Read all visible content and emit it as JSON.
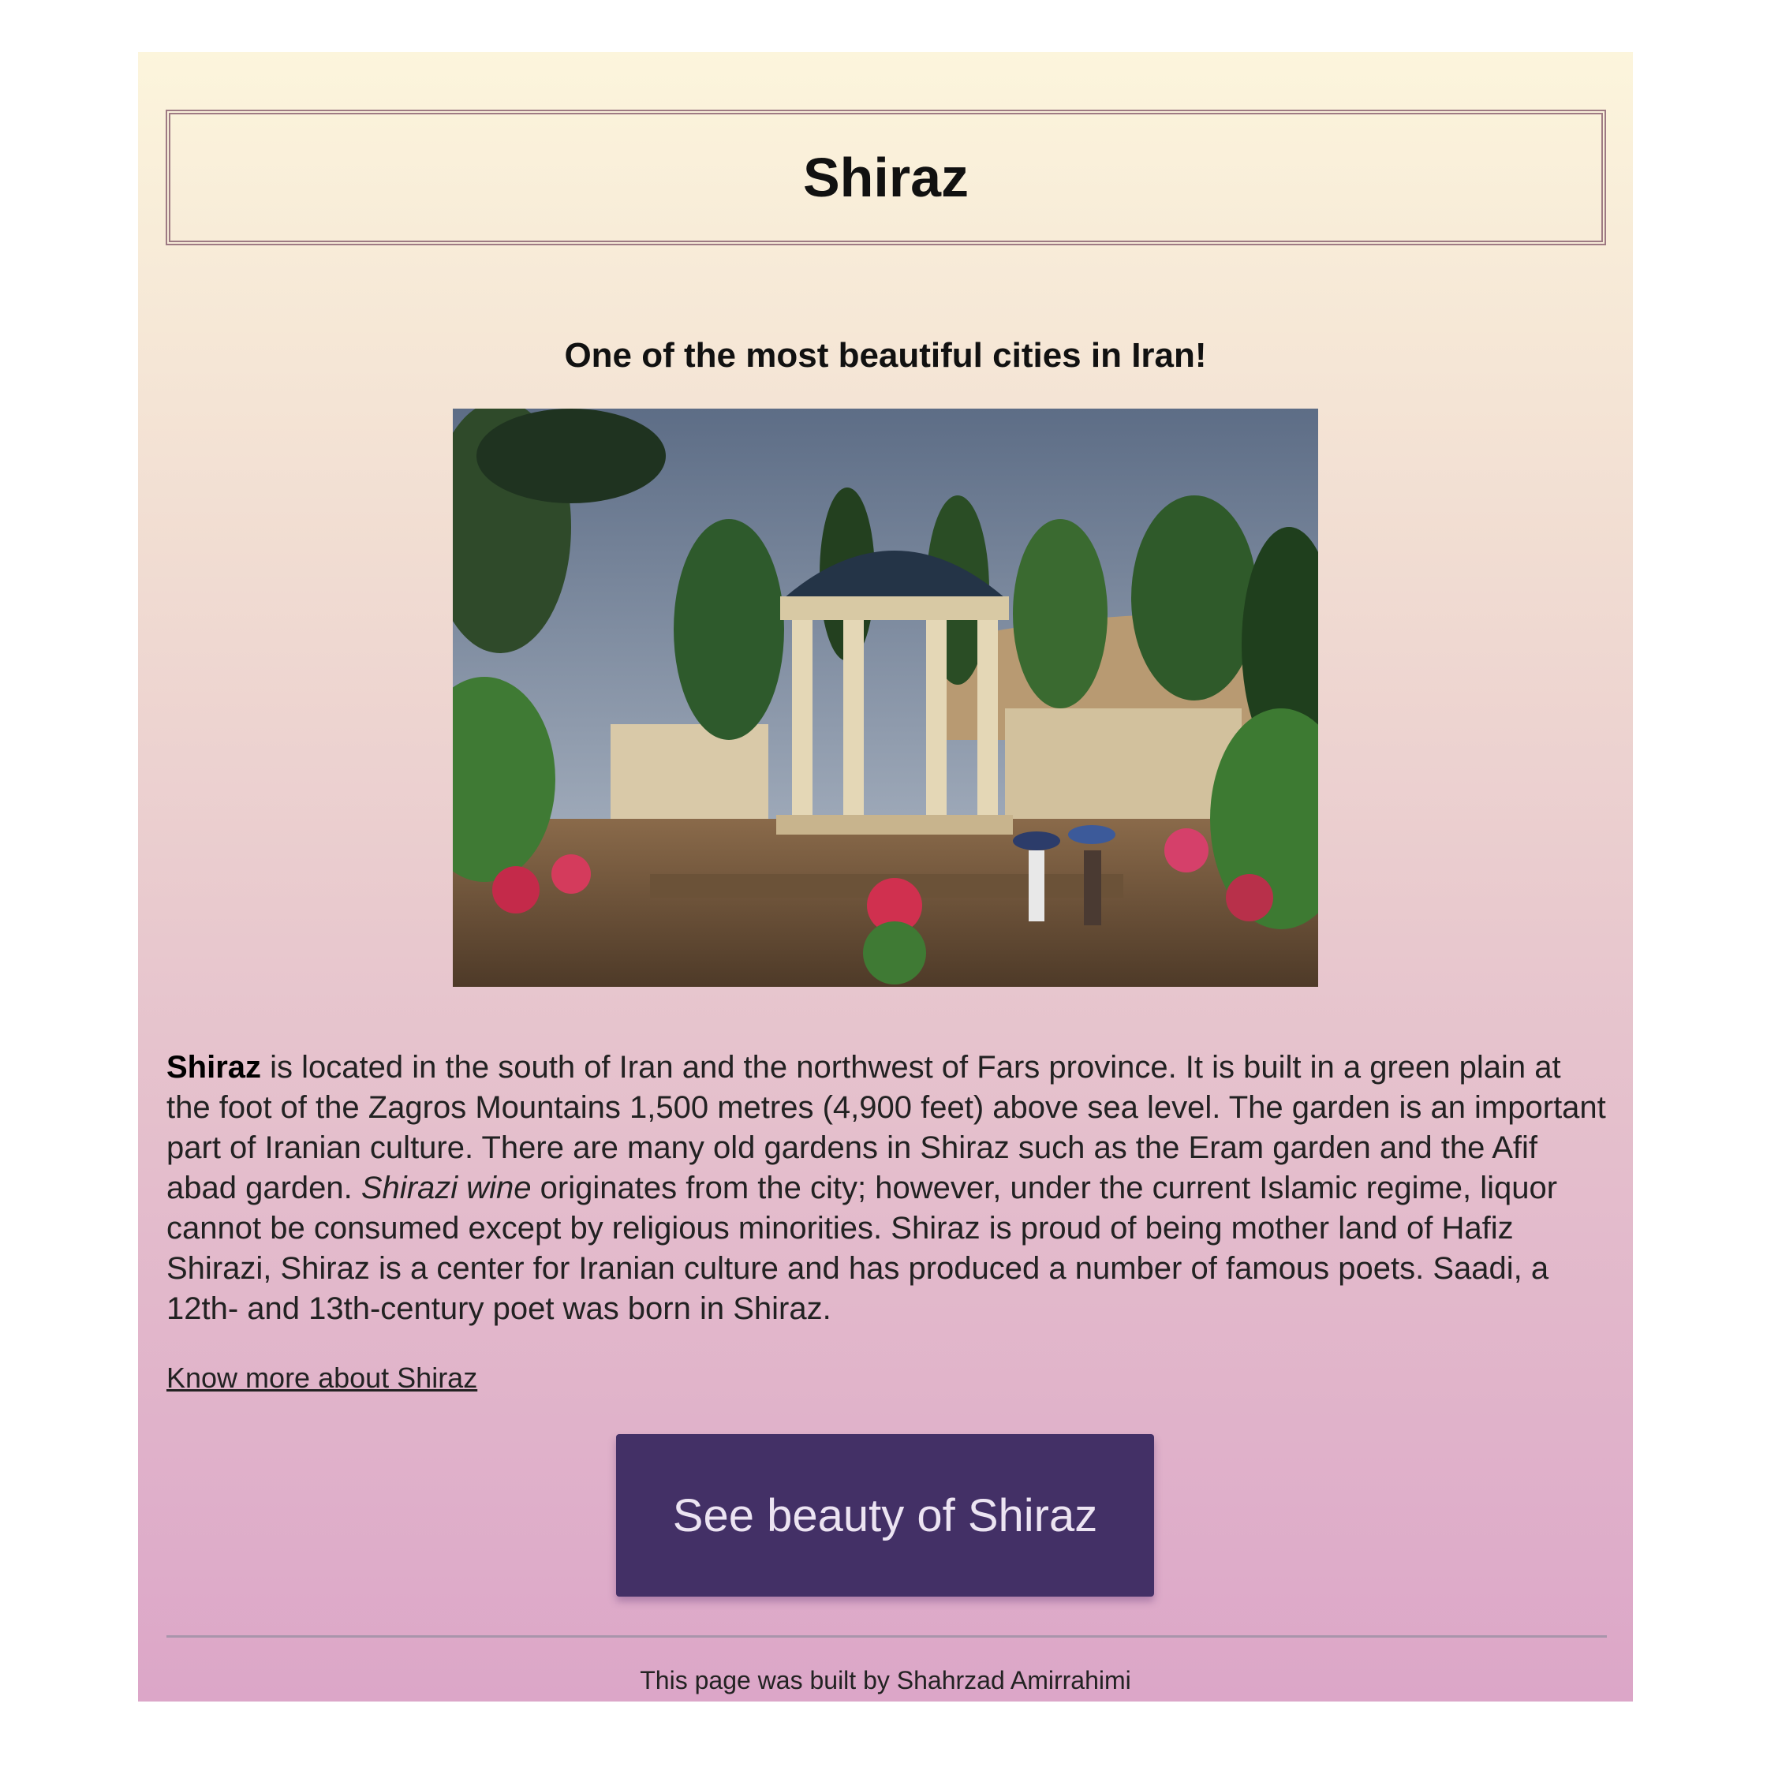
{
  "header": {
    "title": "Shiraz"
  },
  "subtitle": "One of the most beautiful cities in Iran!",
  "photo": {
    "description_icon": "garden-pavilion-photo"
  },
  "description": {
    "lead_bold": "Shiraz",
    "part1": " is located in the south of Iran and the northwest of Fars province. It is built in a green plain at the foot of the Zagros Mountains 1,500 metres (4,900 feet) above sea level. The garden is an important part of Iranian culture. There are many old gardens in Shiraz such as the Eram garden and the Afif abad garden. ",
    "italic": "Shirazi wine",
    "part2": " originates from the city; however, under the current Islamic regime, liquor cannot be consumed except by religious minorities. Shiraz is proud of being mother land of Hafiz Shirazi, Shiraz is a center for Iranian culture and has produced a number of famous poets. Saadi, a 12th- and 13th-century poet was born in Shiraz."
  },
  "link_text": "Know more about Shiraz",
  "cta_label": "See beauty of Shiraz",
  "footer_text": "This page was built by Shahrzad Amirrahimi",
  "colors": {
    "button": "#433066",
    "gradient_top": "#fcf5dc",
    "gradient_bottom": "#dca6c8"
  }
}
